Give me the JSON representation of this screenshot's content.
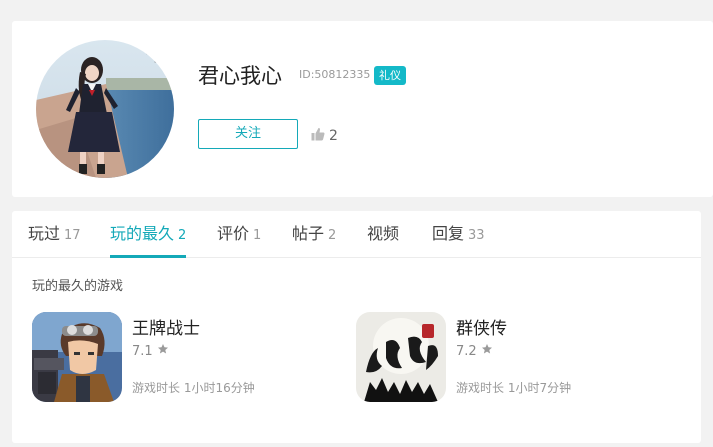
{
  "profile": {
    "name": "君心我心",
    "id_label": "ID:50812335",
    "badge": "礼仪",
    "follow_label": "关注",
    "like_count": "2"
  },
  "tabs": [
    {
      "label": "玩过",
      "count": "17"
    },
    {
      "label": "玩的最久",
      "count": "2"
    },
    {
      "label": "评价",
      "count": "1"
    },
    {
      "label": "帖子",
      "count": "2"
    },
    {
      "label": "视频",
      "count": ""
    },
    {
      "label": "回复",
      "count": "33"
    }
  ],
  "active_tab": "玩的最久",
  "section": {
    "title": "玩的最久的游戏"
  },
  "games": [
    {
      "name": "王牌战士",
      "rating": "7.1",
      "time_label": "游戏时长",
      "time_value": "1小时16分钟",
      "icon": "soldier-game-icon"
    },
    {
      "name": "群侠传",
      "rating": "7.2",
      "time_label": "游戏时长",
      "time_value": "1小时7分钟",
      "icon": "calligraphy-game-icon"
    }
  ],
  "icons": {
    "like": "thumbs-up-icon",
    "star": "star-icon"
  },
  "colors": {
    "accent": "#14a9b8",
    "badge": "#14b9c8",
    "background": "#f2f2f2"
  }
}
